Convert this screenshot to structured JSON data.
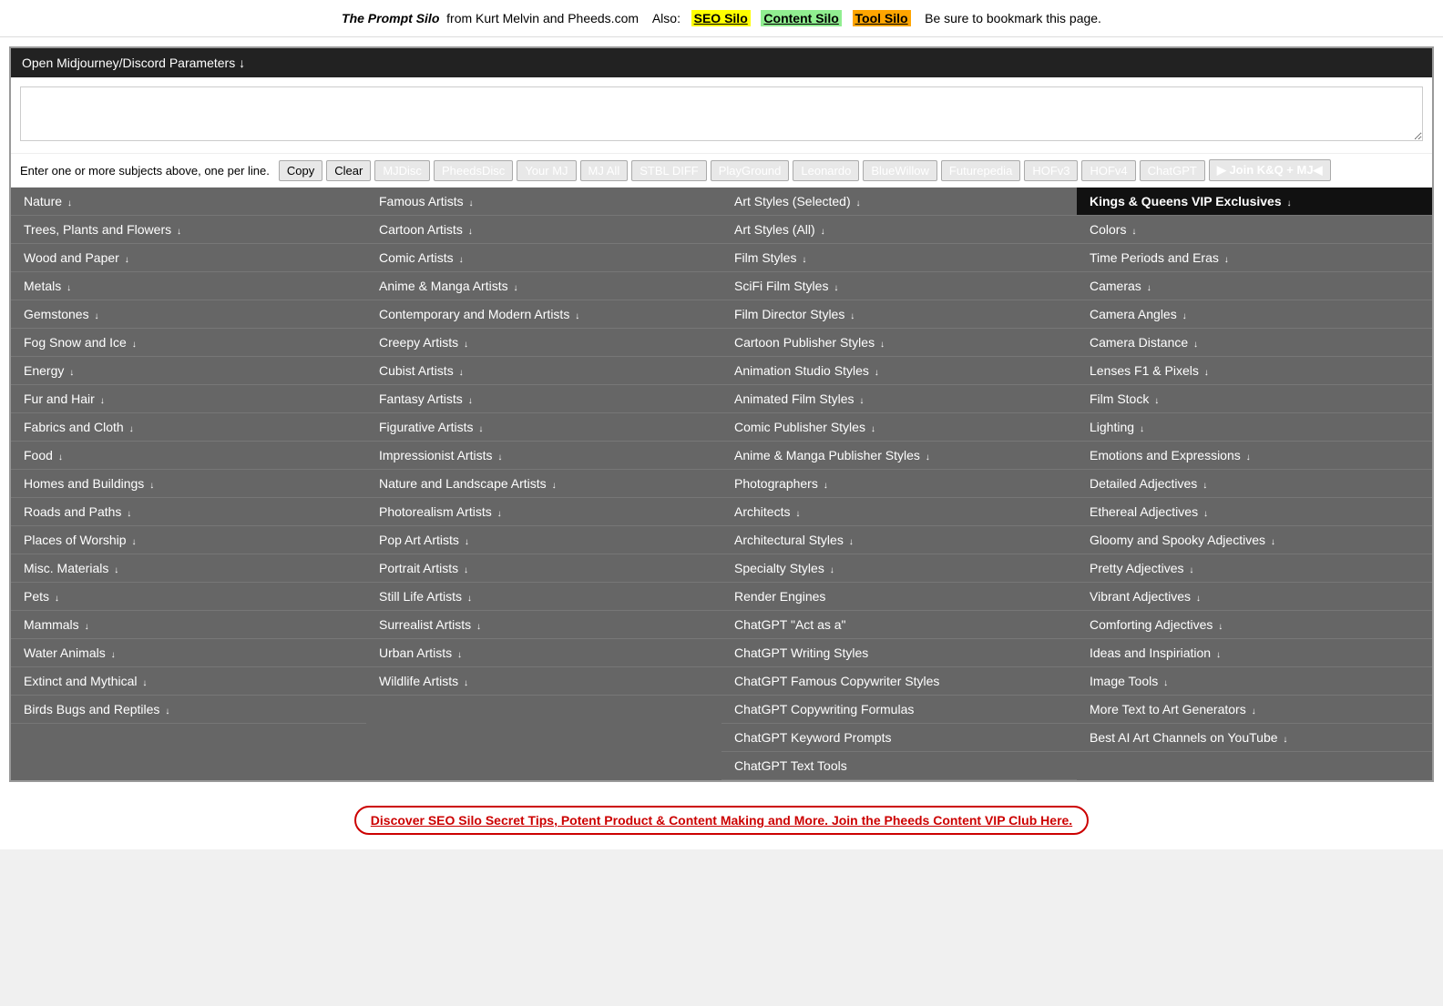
{
  "header": {
    "title": "The Prompt Silo",
    "from_text": "from Kurt Melvin and Pheeds.com",
    "also_text": "Also:",
    "links": [
      {
        "label": "SEO Silo",
        "color": "yellow"
      },
      {
        "label": "Content Silo",
        "color": "green"
      },
      {
        "label": "Tool Silo",
        "color": "orange"
      }
    ],
    "bookmark_text": "Be sure to bookmark this page."
  },
  "dropdown_bar": {
    "label": "Open Midjourney/Discord Parameters ↓"
  },
  "toolbar": {
    "instruction": "Enter one or more subjects above, one per line.",
    "buttons": [
      "Copy",
      "Clear",
      "MJDisc",
      "PheedsDisc",
      "Your MJ",
      "MJ All",
      "STBL DIFF",
      "PlayGround",
      "Leonardo",
      "BlueWillow",
      "Futurepedia",
      "HOFv3",
      "HOFv4",
      "ChatGPT"
    ],
    "join_label": "▶ Join K&Q + MJ◀"
  },
  "columns": [
    {
      "id": "col1",
      "items": [
        {
          "label": "Nature",
          "chevron": true
        },
        {
          "label": "Trees, Plants and Flowers",
          "chevron": true
        },
        {
          "label": "Wood and Paper",
          "chevron": true
        },
        {
          "label": "Metals",
          "chevron": true
        },
        {
          "label": "Gemstones",
          "chevron": true
        },
        {
          "label": "Fog Snow and Ice",
          "chevron": true
        },
        {
          "label": "Energy",
          "chevron": true
        },
        {
          "label": "Fur and Hair",
          "chevron": true
        },
        {
          "label": "Fabrics and Cloth",
          "chevron": true
        },
        {
          "label": "Food",
          "chevron": true
        },
        {
          "label": "Homes and Buildings",
          "chevron": true
        },
        {
          "label": "Roads and Paths",
          "chevron": true
        },
        {
          "label": "Places of Worship",
          "chevron": true
        },
        {
          "label": "Misc. Materials",
          "chevron": true
        },
        {
          "label": "Pets",
          "chevron": true
        },
        {
          "label": "Mammals",
          "chevron": true
        },
        {
          "label": "Water Animals",
          "chevron": true
        },
        {
          "label": "Extinct and Mythical",
          "chevron": true
        },
        {
          "label": "Birds Bugs and Reptiles",
          "chevron": true
        }
      ]
    },
    {
      "id": "col2",
      "items": [
        {
          "label": "Famous Artists",
          "chevron": true
        },
        {
          "label": "Cartoon Artists",
          "chevron": true
        },
        {
          "label": "Comic Artists",
          "chevron": true
        },
        {
          "label": "Anime & Manga Artists",
          "chevron": true
        },
        {
          "label": "Contemporary and Modern Artists",
          "chevron": true
        },
        {
          "label": "Creepy Artists",
          "chevron": true
        },
        {
          "label": "Cubist Artists",
          "chevron": true
        },
        {
          "label": "Fantasy Artists",
          "chevron": true
        },
        {
          "label": "Figurative Artists",
          "chevron": true
        },
        {
          "label": "Impressionist Artists",
          "chevron": true
        },
        {
          "label": "Nature and Landscape Artists",
          "chevron": true
        },
        {
          "label": "Photorealism Artists",
          "chevron": true
        },
        {
          "label": "Pop Art Artists",
          "chevron": true
        },
        {
          "label": "Portrait Artists",
          "chevron": true
        },
        {
          "label": "Still Life Artists",
          "chevron": true
        },
        {
          "label": "Surrealist Artists",
          "chevron": true
        },
        {
          "label": "Urban Artists",
          "chevron": true
        },
        {
          "label": "Wildlife Artists",
          "chevron": true
        }
      ]
    },
    {
      "id": "col3",
      "items": [
        {
          "label": "Art Styles (Selected)",
          "chevron": true
        },
        {
          "label": "Art Styles (All)",
          "chevron": true
        },
        {
          "label": "Film Styles",
          "chevron": true
        },
        {
          "label": "SciFi Film Styles",
          "chevron": true
        },
        {
          "label": "Film Director Styles",
          "chevron": true
        },
        {
          "label": "Cartoon Publisher Styles",
          "chevron": true
        },
        {
          "label": "Animation Studio Styles",
          "chevron": true
        },
        {
          "label": "Animated Film Styles",
          "chevron": true
        },
        {
          "label": "Comic Publisher Styles",
          "chevron": true
        },
        {
          "label": "Anime & Manga Publisher Styles",
          "chevron": true
        },
        {
          "label": "Photographers",
          "chevron": true
        },
        {
          "label": "Architects",
          "chevron": true
        },
        {
          "label": "Architectural Styles",
          "chevron": true
        },
        {
          "label": "Specialty Styles",
          "chevron": true
        },
        {
          "label": "Render Engines",
          "chevron": false
        },
        {
          "label": "ChatGPT \"Act as a\"",
          "chevron": false
        },
        {
          "label": "ChatGPT Writing Styles",
          "chevron": false
        },
        {
          "label": "ChatGPT Famous Copywriter Styles",
          "chevron": false
        },
        {
          "label": "ChatGPT Copywriting Formulas",
          "chevron": false
        },
        {
          "label": "ChatGPT Keyword Prompts",
          "chevron": false
        },
        {
          "label": "ChatGPT Text Tools",
          "chevron": false
        }
      ]
    },
    {
      "id": "col4",
      "items": [
        {
          "label": "Kings & Queens VIP Exclusives",
          "chevron": true,
          "highlighted": true
        },
        {
          "label": "Colors",
          "chevron": true
        },
        {
          "label": "Time Periods and Eras",
          "chevron": true
        },
        {
          "label": "Cameras",
          "chevron": true
        },
        {
          "label": "Camera Angles",
          "chevron": true
        },
        {
          "label": "Camera Distance",
          "chevron": true
        },
        {
          "label": "Lenses F1 & Pixels",
          "chevron": true
        },
        {
          "label": "Film Stock",
          "chevron": true
        },
        {
          "label": "Lighting",
          "chevron": true
        },
        {
          "label": "Emotions and Expressions",
          "chevron": true
        },
        {
          "label": "Detailed Adjectives",
          "chevron": true
        },
        {
          "label": "Ethereal Adjectives",
          "chevron": true
        },
        {
          "label": "Gloomy and Spooky Adjectives",
          "chevron": true
        },
        {
          "label": "Pretty Adjectives",
          "chevron": true
        },
        {
          "label": "Vibrant Adjectives",
          "chevron": true
        },
        {
          "label": "Comforting Adjectives",
          "chevron": true
        },
        {
          "label": "Ideas and Inspiriation",
          "chevron": true
        },
        {
          "label": "Image Tools",
          "chevron": true
        },
        {
          "label": "More Text to Art Generators",
          "chevron": true
        },
        {
          "label": "Best AI Art Channels on YouTube",
          "chevron": true
        }
      ]
    }
  ],
  "footer": {
    "link_text": "Discover SEO Silo Secret Tips, Potent Product & Content Making and More. Join the Pheeds Content VIP Club Here."
  }
}
